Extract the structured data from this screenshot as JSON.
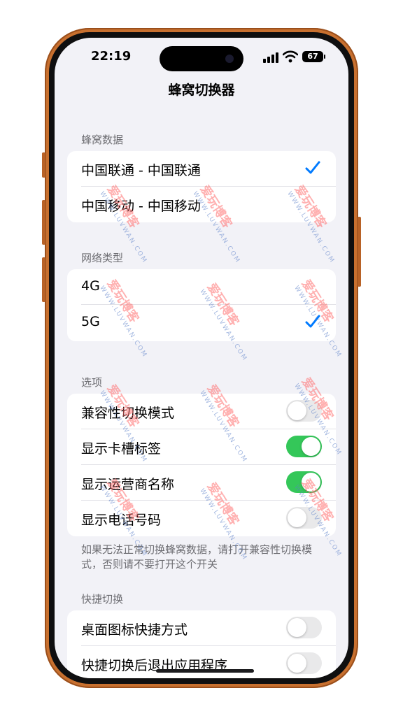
{
  "status_bar": {
    "time": "22:19",
    "battery": "67",
    "signal_icon": "cellular-signal-icon",
    "wifi_icon": "wifi-icon",
    "battery_icon": "battery-icon"
  },
  "nav": {
    "title": "蜂窝切换器"
  },
  "sections": {
    "cellular": {
      "header": "蜂窝数据",
      "items": [
        {
          "label": "中国联通 - 中国联通",
          "checked": true
        },
        {
          "label": "中国移动 - 中国移动",
          "checked": false
        }
      ]
    },
    "network": {
      "header": "网络类型",
      "items": [
        {
          "label": "4G",
          "checked": false
        },
        {
          "label": "5G",
          "checked": true
        }
      ]
    },
    "options": {
      "header": "选项",
      "items": [
        {
          "label": "兼容性切换模式",
          "on": false
        },
        {
          "label": "显示卡槽标签",
          "on": true
        },
        {
          "label": "显示运营商名称",
          "on": true
        },
        {
          "label": "显示电话号码",
          "on": false
        }
      ],
      "footer": "如果无法正常切换蜂窝数据，请打开兼容性切换模式，否则请不要打开这个开关"
    },
    "shortcuts": {
      "header": "快捷切换",
      "items": [
        {
          "label": "桌面图标快捷方式",
          "on": false
        },
        {
          "label": "快捷切换后退出应用程序",
          "on": false
        }
      ]
    }
  },
  "watermark": {
    "cn": "爱玩博客",
    "en": "WWW.LUVWAN.COM"
  },
  "colors": {
    "accent": "#007aff",
    "toggle_on": "#34c759",
    "toggle_off": "#e9e9ea",
    "background": "#f2f2f7",
    "frame": "#c8702f"
  }
}
